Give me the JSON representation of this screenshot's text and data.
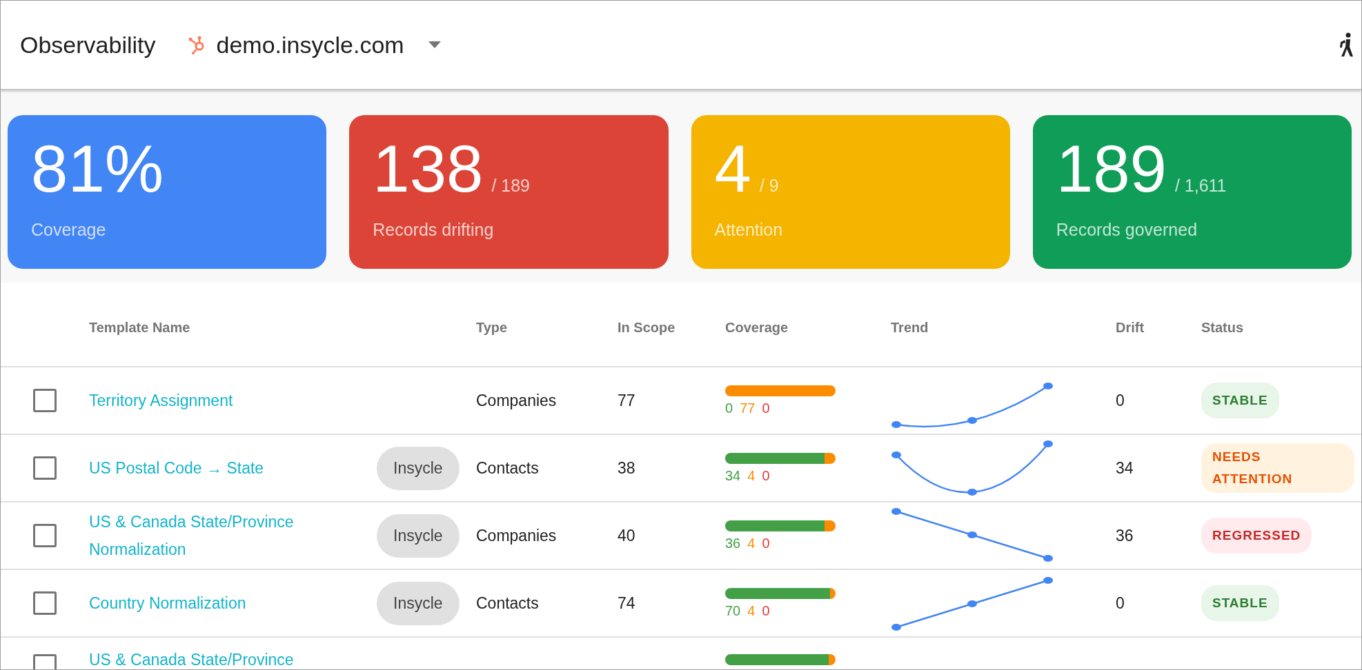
{
  "header": {
    "title": "Observability",
    "account": "demo.insycle.com"
  },
  "cards": [
    {
      "value": "81%",
      "label": "Coverage",
      "color": "#4285f4"
    },
    {
      "value": "138",
      "total": "/ 189",
      "label": "Records drifting",
      "color": "#db4437"
    },
    {
      "value": "4",
      "total": "/ 9",
      "label": "Attention",
      "color": "#f4b400"
    },
    {
      "value": "189",
      "total": "/ 1,611",
      "label": "Records governed",
      "color": "#0f9d58"
    }
  ],
  "table": {
    "columns": [
      "Template Name",
      "Type",
      "In Scope",
      "Coverage",
      "Trend",
      "Drift",
      "Status"
    ],
    "rows": [
      {
        "checked": false,
        "name": "Territory Assignment",
        "type": "Companies",
        "in_scope": "77",
        "coverage": [
          {
            "kind": "good",
            "text": "0",
            "level": 0
          },
          {
            "kind": "warn",
            "text": "77",
            "level": 1
          },
          {
            "kind": "bad",
            "text": "0",
            "level": 0
          }
        ],
        "trend": {
          "kind": "curve-up"
        },
        "drift": "0",
        "status": {
          "kind": "stable",
          "label": "STABLE"
        }
      },
      {
        "checked": false,
        "name": "US Postal Code → State",
        "source": "Insycle",
        "type": "Contacts",
        "in_scope": "38",
        "coverage": [
          {
            "kind": "good",
            "text": "34",
            "level": 0.9
          },
          {
            "kind": "warn",
            "text": "4",
            "level": 0.1
          },
          {
            "kind": "bad",
            "text": "0",
            "level": 0
          }
        ],
        "trend": {
          "kind": "dip"
        },
        "drift": "34",
        "status": {
          "kind": "attention",
          "label": "NEEDS ATTENTION"
        }
      },
      {
        "checked": false,
        "name": "US & Canada State/Province Normalization",
        "source": "Insycle",
        "type": "Companies",
        "in_scope": "40",
        "coverage": [
          {
            "kind": "good",
            "text": "36",
            "level": 0.9
          },
          {
            "kind": "warn",
            "text": "4",
            "level": 0.1
          },
          {
            "kind": "bad",
            "text": "0",
            "level": 0
          }
        ],
        "trend": {
          "kind": "down"
        },
        "drift": "36",
        "status": {
          "kind": "regressed",
          "label": "REGRESSED"
        }
      },
      {
        "checked": false,
        "name": "Country Normalization",
        "source": "Insycle",
        "type": "Contacts",
        "in_scope": "74",
        "coverage": [
          {
            "kind": "good",
            "text": "70",
            "level": 0.95
          },
          {
            "kind": "warn",
            "text": "4",
            "level": 0.05
          },
          {
            "kind": "bad",
            "text": "0",
            "level": 0
          }
        ],
        "trend": {
          "kind": "up"
        },
        "drift": "0",
        "status": {
          "kind": "stable",
          "label": "STABLE"
        }
      },
      {
        "checked": false,
        "name": "US & Canada State/Province",
        "coverage": [
          {
            "kind": "good",
            "level": 0.94
          },
          {
            "kind": "warn",
            "level": 0.06
          },
          {
            "kind": "bad",
            "level": 0
          }
        ]
      }
    ]
  }
}
